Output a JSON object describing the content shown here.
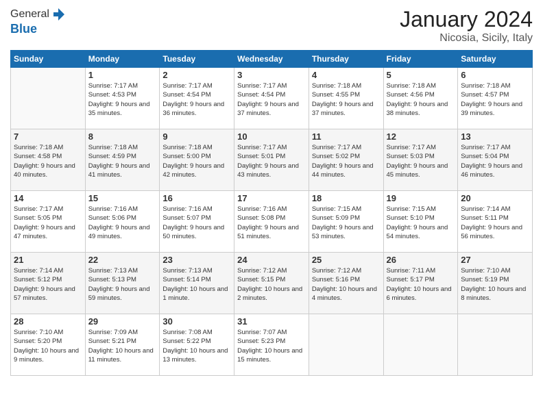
{
  "header": {
    "logo_general": "General",
    "logo_blue": "Blue",
    "month_title": "January 2024",
    "location": "Nicosia, Sicily, Italy"
  },
  "days_of_week": [
    "Sunday",
    "Monday",
    "Tuesday",
    "Wednesday",
    "Thursday",
    "Friday",
    "Saturday"
  ],
  "weeks": [
    [
      {
        "day": "",
        "sunrise": "",
        "sunset": "",
        "daylight": ""
      },
      {
        "day": "1",
        "sunrise": "Sunrise: 7:17 AM",
        "sunset": "Sunset: 4:53 PM",
        "daylight": "Daylight: 9 hours and 35 minutes."
      },
      {
        "day": "2",
        "sunrise": "Sunrise: 7:17 AM",
        "sunset": "Sunset: 4:54 PM",
        "daylight": "Daylight: 9 hours and 36 minutes."
      },
      {
        "day": "3",
        "sunrise": "Sunrise: 7:17 AM",
        "sunset": "Sunset: 4:54 PM",
        "daylight": "Daylight: 9 hours and 37 minutes."
      },
      {
        "day": "4",
        "sunrise": "Sunrise: 7:18 AM",
        "sunset": "Sunset: 4:55 PM",
        "daylight": "Daylight: 9 hours and 37 minutes."
      },
      {
        "day": "5",
        "sunrise": "Sunrise: 7:18 AM",
        "sunset": "Sunset: 4:56 PM",
        "daylight": "Daylight: 9 hours and 38 minutes."
      },
      {
        "day": "6",
        "sunrise": "Sunrise: 7:18 AM",
        "sunset": "Sunset: 4:57 PM",
        "daylight": "Daylight: 9 hours and 39 minutes."
      }
    ],
    [
      {
        "day": "7",
        "sunrise": "Sunrise: 7:18 AM",
        "sunset": "Sunset: 4:58 PM",
        "daylight": "Daylight: 9 hours and 40 minutes."
      },
      {
        "day": "8",
        "sunrise": "Sunrise: 7:18 AM",
        "sunset": "Sunset: 4:59 PM",
        "daylight": "Daylight: 9 hours and 41 minutes."
      },
      {
        "day": "9",
        "sunrise": "Sunrise: 7:18 AM",
        "sunset": "Sunset: 5:00 PM",
        "daylight": "Daylight: 9 hours and 42 minutes."
      },
      {
        "day": "10",
        "sunrise": "Sunrise: 7:17 AM",
        "sunset": "Sunset: 5:01 PM",
        "daylight": "Daylight: 9 hours and 43 minutes."
      },
      {
        "day": "11",
        "sunrise": "Sunrise: 7:17 AM",
        "sunset": "Sunset: 5:02 PM",
        "daylight": "Daylight: 9 hours and 44 minutes."
      },
      {
        "day": "12",
        "sunrise": "Sunrise: 7:17 AM",
        "sunset": "Sunset: 5:03 PM",
        "daylight": "Daylight: 9 hours and 45 minutes."
      },
      {
        "day": "13",
        "sunrise": "Sunrise: 7:17 AM",
        "sunset": "Sunset: 5:04 PM",
        "daylight": "Daylight: 9 hours and 46 minutes."
      }
    ],
    [
      {
        "day": "14",
        "sunrise": "Sunrise: 7:17 AM",
        "sunset": "Sunset: 5:05 PM",
        "daylight": "Daylight: 9 hours and 47 minutes."
      },
      {
        "day": "15",
        "sunrise": "Sunrise: 7:16 AM",
        "sunset": "Sunset: 5:06 PM",
        "daylight": "Daylight: 9 hours and 49 minutes."
      },
      {
        "day": "16",
        "sunrise": "Sunrise: 7:16 AM",
        "sunset": "Sunset: 5:07 PM",
        "daylight": "Daylight: 9 hours and 50 minutes."
      },
      {
        "day": "17",
        "sunrise": "Sunrise: 7:16 AM",
        "sunset": "Sunset: 5:08 PM",
        "daylight": "Daylight: 9 hours and 51 minutes."
      },
      {
        "day": "18",
        "sunrise": "Sunrise: 7:15 AM",
        "sunset": "Sunset: 5:09 PM",
        "daylight": "Daylight: 9 hours and 53 minutes."
      },
      {
        "day": "19",
        "sunrise": "Sunrise: 7:15 AM",
        "sunset": "Sunset: 5:10 PM",
        "daylight": "Daylight: 9 hours and 54 minutes."
      },
      {
        "day": "20",
        "sunrise": "Sunrise: 7:14 AM",
        "sunset": "Sunset: 5:11 PM",
        "daylight": "Daylight: 9 hours and 56 minutes."
      }
    ],
    [
      {
        "day": "21",
        "sunrise": "Sunrise: 7:14 AM",
        "sunset": "Sunset: 5:12 PM",
        "daylight": "Daylight: 9 hours and 57 minutes."
      },
      {
        "day": "22",
        "sunrise": "Sunrise: 7:13 AM",
        "sunset": "Sunset: 5:13 PM",
        "daylight": "Daylight: 9 hours and 59 minutes."
      },
      {
        "day": "23",
        "sunrise": "Sunrise: 7:13 AM",
        "sunset": "Sunset: 5:14 PM",
        "daylight": "Daylight: 10 hours and 1 minute."
      },
      {
        "day": "24",
        "sunrise": "Sunrise: 7:12 AM",
        "sunset": "Sunset: 5:15 PM",
        "daylight": "Daylight: 10 hours and 2 minutes."
      },
      {
        "day": "25",
        "sunrise": "Sunrise: 7:12 AM",
        "sunset": "Sunset: 5:16 PM",
        "daylight": "Daylight: 10 hours and 4 minutes."
      },
      {
        "day": "26",
        "sunrise": "Sunrise: 7:11 AM",
        "sunset": "Sunset: 5:17 PM",
        "daylight": "Daylight: 10 hours and 6 minutes."
      },
      {
        "day": "27",
        "sunrise": "Sunrise: 7:10 AM",
        "sunset": "Sunset: 5:19 PM",
        "daylight": "Daylight: 10 hours and 8 minutes."
      }
    ],
    [
      {
        "day": "28",
        "sunrise": "Sunrise: 7:10 AM",
        "sunset": "Sunset: 5:20 PM",
        "daylight": "Daylight: 10 hours and 9 minutes."
      },
      {
        "day": "29",
        "sunrise": "Sunrise: 7:09 AM",
        "sunset": "Sunset: 5:21 PM",
        "daylight": "Daylight: 10 hours and 11 minutes."
      },
      {
        "day": "30",
        "sunrise": "Sunrise: 7:08 AM",
        "sunset": "Sunset: 5:22 PM",
        "daylight": "Daylight: 10 hours and 13 minutes."
      },
      {
        "day": "31",
        "sunrise": "Sunrise: 7:07 AM",
        "sunset": "Sunset: 5:23 PM",
        "daylight": "Daylight: 10 hours and 15 minutes."
      },
      {
        "day": "",
        "sunrise": "",
        "sunset": "",
        "daylight": ""
      },
      {
        "day": "",
        "sunrise": "",
        "sunset": "",
        "daylight": ""
      },
      {
        "day": "",
        "sunrise": "",
        "sunset": "",
        "daylight": ""
      }
    ]
  ]
}
